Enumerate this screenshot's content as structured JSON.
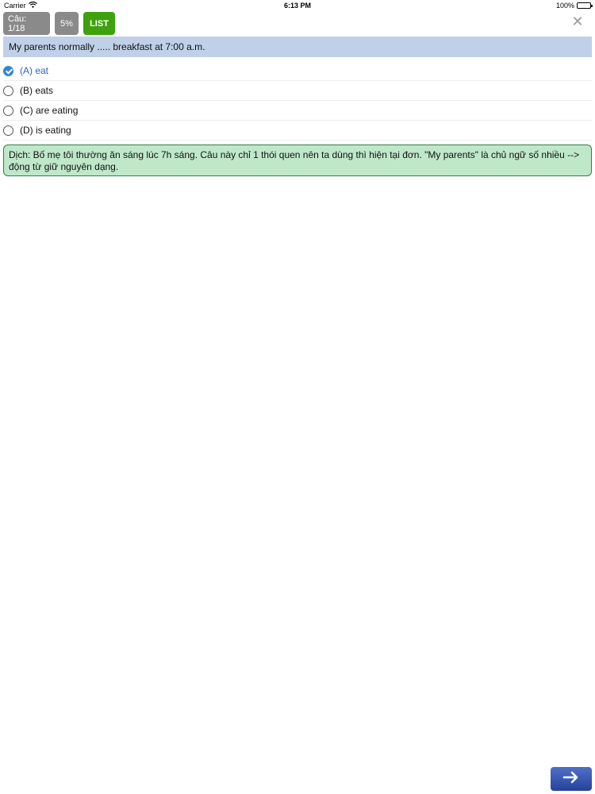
{
  "status_bar": {
    "carrier": "Carrier",
    "time": "6:13 PM",
    "battery": "100%"
  },
  "toolbar": {
    "counter_label": "Câu: 1/18",
    "percent_label": "5%",
    "list_label": "LIST"
  },
  "question": {
    "text": "My parents normally ..... breakfast at 7:00 a.m."
  },
  "options": [
    {
      "label": "(A) eat",
      "selected": true
    },
    {
      "label": "(B) eats",
      "selected": false
    },
    {
      "label": "(C) are eating",
      "selected": false
    },
    {
      "label": "(D) is eating",
      "selected": false
    }
  ],
  "explanation": {
    "text": "Dịch: Bố mẹ tôi thường ăn sáng lúc 7h sáng. Câu này chỉ 1 thói quen nên ta dùng thì hiện tại đơn. \"My parents\" là chủ ngữ số nhiều --> động từ giữ nguyên dạng."
  },
  "colors": {
    "question_bg": "#bfd0e8",
    "explanation_bg": "#bfe8c9",
    "list_button": "#3fa10e",
    "selected_text": "#2d63c8",
    "next_button": "#26439a"
  },
  "icons": {
    "close": "close-icon",
    "next": "arrow-right-icon",
    "wifi": "wifi-icon",
    "battery": "battery-icon"
  }
}
